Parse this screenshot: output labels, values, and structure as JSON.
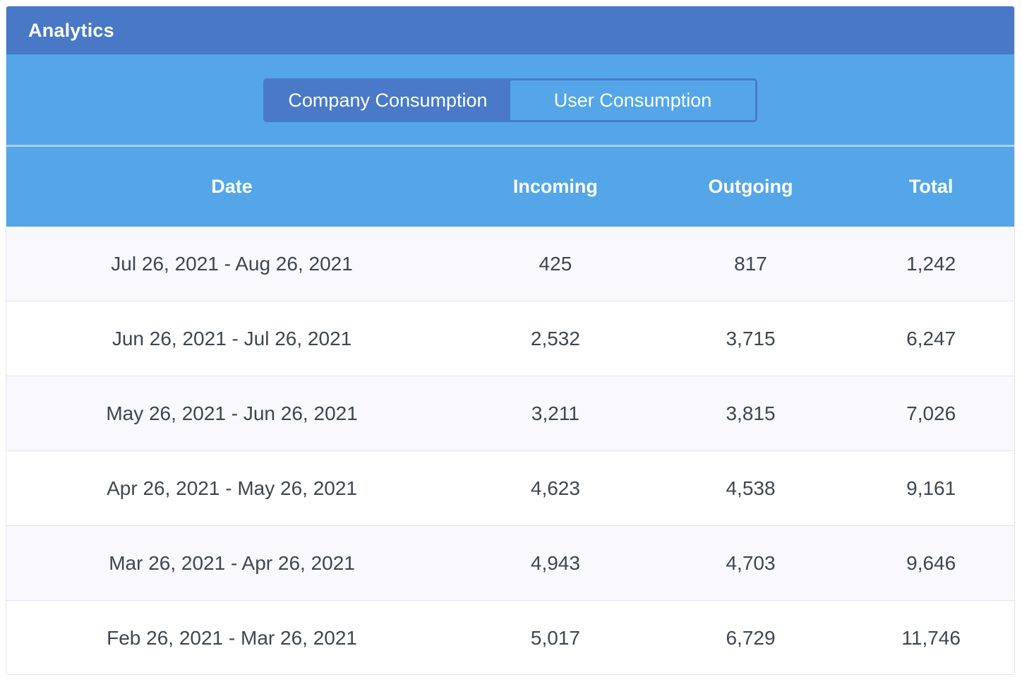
{
  "header": {
    "title": "Analytics"
  },
  "toggle": {
    "options": [
      {
        "label": "Company Consumption",
        "active": true
      },
      {
        "label": "User Consumption",
        "active": false
      }
    ]
  },
  "table": {
    "columns": [
      "Date",
      "Incoming",
      "Outgoing",
      "Total"
    ],
    "rows": [
      [
        "Jul 26, 2021 - Aug 26, 2021",
        "425",
        "817",
        "1,242"
      ],
      [
        "Jun 26, 2021 - Jul 26, 2021",
        "2,532",
        "3,715",
        "6,247"
      ],
      [
        "May 26, 2021 - Jun 26, 2021",
        "3,211",
        "3,815",
        "7,026"
      ],
      [
        "Apr 26, 2021 - May 26, 2021",
        "4,623",
        "4,538",
        "9,161"
      ],
      [
        "Mar 26, 2021 - Apr 26, 2021",
        "4,943",
        "4,703",
        "9,646"
      ],
      [
        "Feb 26, 2021 - Mar 26, 2021",
        "5,017",
        "6,729",
        "11,746"
      ]
    ]
  },
  "colors": {
    "title_bar": "#4878c6",
    "header_bg": "#54a6e8",
    "active_toggle": "#4a79c8",
    "row_text": "#3f4650",
    "row_alt": "#f8f8fd"
  }
}
